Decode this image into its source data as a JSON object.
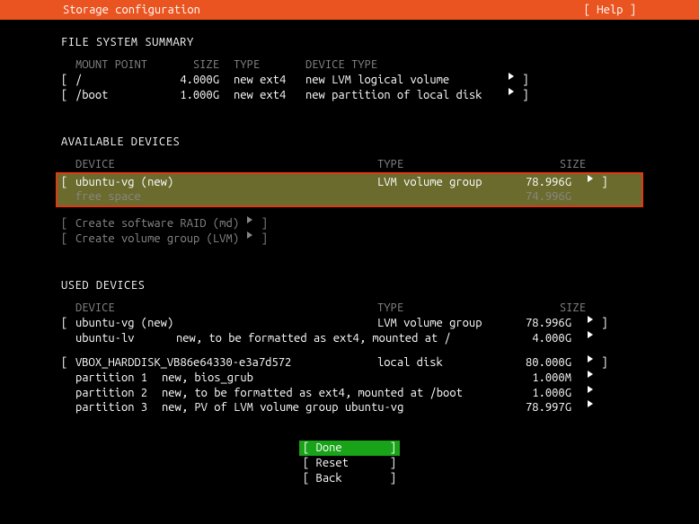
{
  "header": {
    "title": "Storage configuration",
    "help": "[ Help ]"
  },
  "fss": {
    "title": "FILE SYSTEM SUMMARY",
    "cols": {
      "mount": "MOUNT POINT",
      "size": "SIZE",
      "type": "TYPE",
      "devtype": "DEVICE TYPE"
    },
    "rows": [
      {
        "mount": "/",
        "size": "4.000G",
        "type": "new ext4",
        "devtype": "new LVM logical volume"
      },
      {
        "mount": "/boot",
        "size": "1.000G",
        "type": "new ext4",
        "devtype": "new partition of local disk"
      }
    ]
  },
  "avail": {
    "title": "AVAILABLE DEVICES",
    "cols": {
      "device": "DEVICE",
      "type": "TYPE",
      "size": "SIZE"
    },
    "selected": {
      "name": "ubuntu-vg (new)",
      "type": "LVM volume group",
      "size": "78.996G",
      "free_label": "free space",
      "free_size": "74.996G"
    },
    "raid": "Create software RAID (md)",
    "lvm": "Create volume group (LVM)"
  },
  "used": {
    "title": "USED DEVICES",
    "cols": {
      "device": "DEVICE",
      "type": "TYPE",
      "size": "SIZE"
    },
    "vg": {
      "name": "ubuntu-vg (new)",
      "type": "LVM volume group",
      "size": "78.996G"
    },
    "lv": {
      "name": "ubuntu-lv",
      "desc": "new, to be formatted as ext4, mounted at /",
      "size": "4.000G"
    },
    "disk": {
      "name": "VBOX_HARDDISK_VB86e64330-e3a7d572",
      "type": "local disk",
      "size": "80.000G"
    },
    "p1": {
      "name": "partition 1",
      "desc": "new, bios_grub",
      "size": "1.000M"
    },
    "p2": {
      "name": "partition 2",
      "desc": "new, to be formatted as ext4, mounted at /boot",
      "size": "1.000G"
    },
    "p3": {
      "name": "partition 3",
      "desc": "new, PV of LVM volume group ubuntu-vg",
      "size": "78.997G"
    }
  },
  "footer": {
    "done": "Done",
    "reset": "Reset",
    "back": "Back"
  }
}
